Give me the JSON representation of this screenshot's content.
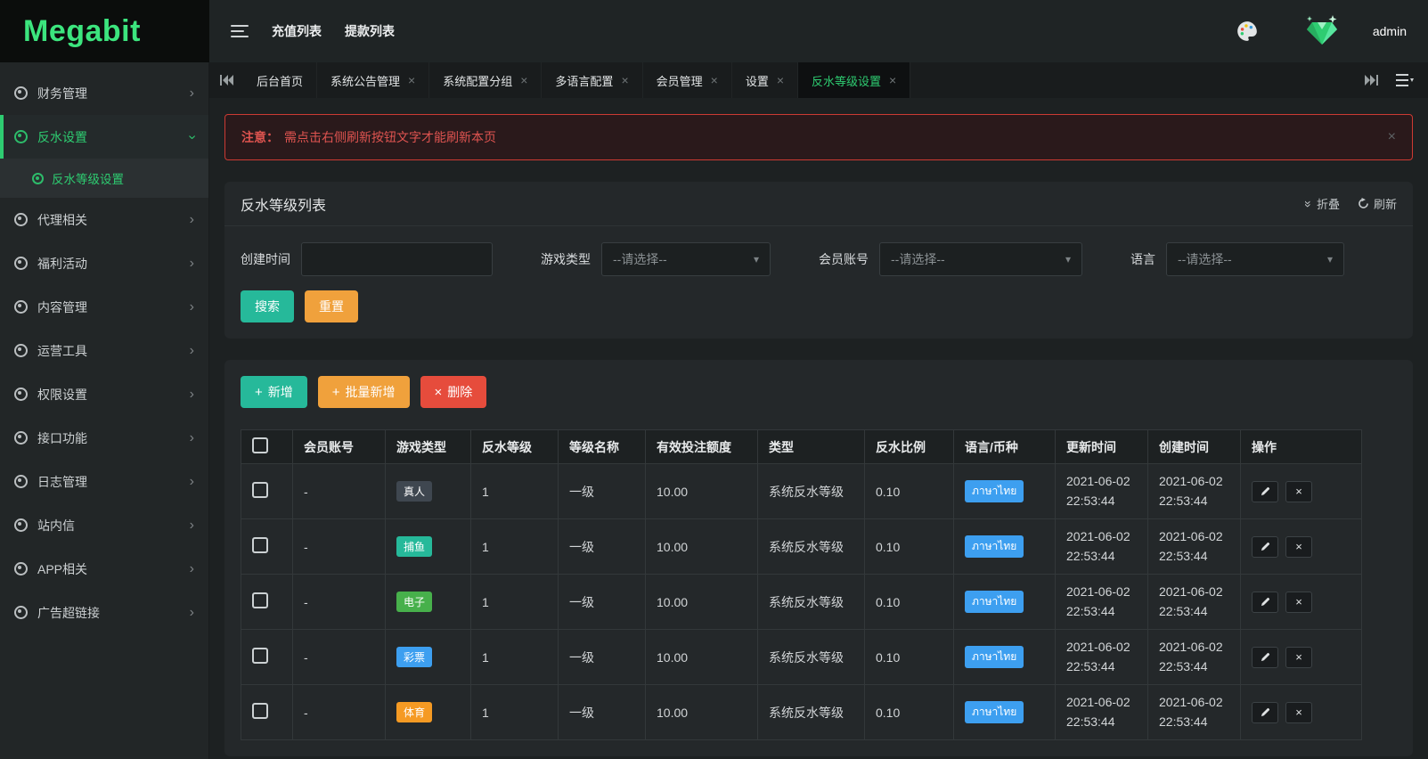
{
  "brand": {
    "logo_text": "Megabit"
  },
  "topnav": {
    "items": [
      "充值列表",
      "提款列表"
    ],
    "username": "admin"
  },
  "sidebar": {
    "items": [
      {
        "label": "财务管理"
      },
      {
        "label": "反水设置",
        "active": true,
        "expanded": true,
        "children": [
          {
            "label": "反水等级设置",
            "active": true
          }
        ]
      },
      {
        "label": "代理相关"
      },
      {
        "label": "福利活动"
      },
      {
        "label": "内容管理"
      },
      {
        "label": "运营工具"
      },
      {
        "label": "权限设置"
      },
      {
        "label": "接口功能"
      },
      {
        "label": "日志管理"
      },
      {
        "label": "站内信"
      },
      {
        "label": "APP相关"
      },
      {
        "label": "广告超链接"
      }
    ]
  },
  "tabs": [
    {
      "label": "后台首页",
      "closable": false
    },
    {
      "label": "系统公告管理",
      "closable": true
    },
    {
      "label": "系统配置分组",
      "closable": true
    },
    {
      "label": "多语言配置",
      "closable": true
    },
    {
      "label": "会员管理",
      "closable": true
    },
    {
      "label": "设置",
      "closable": true
    },
    {
      "label": "反水等级设置",
      "closable": true,
      "active": true
    }
  ],
  "alert": {
    "prefix": "注意：",
    "message": "需点击右侧刷新按钮文字才能刷新本页"
  },
  "panel": {
    "title": "反水等级列表",
    "collapse_label": "折叠",
    "refresh_label": "刷新"
  },
  "filters": {
    "created_time": {
      "label": "创建时间",
      "value": ""
    },
    "game_type": {
      "label": "游戏类型",
      "value": "--请选择--"
    },
    "member": {
      "label": "会员账号",
      "value": "--请选择--"
    },
    "language": {
      "label": "语言",
      "value": "--请选择--"
    },
    "search_label": "搜索",
    "reset_label": "重置"
  },
  "toolbar": {
    "add_label": "新增",
    "batch_add_label": "批量新增",
    "delete_label": "删除"
  },
  "table": {
    "headers": [
      "会员账号",
      "游戏类型",
      "反水等级",
      "等级名称",
      "有效投注额度",
      "类型",
      "反水比例",
      "语言/币种",
      "更新时间",
      "创建时间",
      "操作"
    ],
    "language_badge_color": "#3d9ff0",
    "rows": [
      {
        "account": "-",
        "game": {
          "text": "真人",
          "color": "#3f4750"
        },
        "level": "1",
        "level_name": "一级",
        "bet": "10.00",
        "type": "系统反水等级",
        "ratio": "0.10",
        "language": "ภาษาไทย",
        "updated": "2021-06-02 22:53:44",
        "created": "2021-06-02 22:53:44"
      },
      {
        "account": "-",
        "game": {
          "text": "捕鱼",
          "color": "#26b99a"
        },
        "level": "1",
        "level_name": "一级",
        "bet": "10.00",
        "type": "系统反水等级",
        "ratio": "0.10",
        "language": "ภาษาไทย",
        "updated": "2021-06-02 22:53:44",
        "created": "2021-06-02 22:53:44"
      },
      {
        "account": "-",
        "game": {
          "text": "电子",
          "color": "#47b04b"
        },
        "level": "1",
        "level_name": "一级",
        "bet": "10.00",
        "type": "系统反水等级",
        "ratio": "0.10",
        "language": "ภาษาไทย",
        "updated": "2021-06-02 22:53:44",
        "created": "2021-06-02 22:53:44"
      },
      {
        "account": "-",
        "game": {
          "text": "彩票",
          "color": "#3d9ff0"
        },
        "level": "1",
        "level_name": "一级",
        "bet": "10.00",
        "type": "系统反水等级",
        "ratio": "0.10",
        "language": "ภาษาไทย",
        "updated": "2021-06-02 22:53:44",
        "created": "2021-06-02 22:53:44"
      },
      {
        "account": "-",
        "game": {
          "text": "体育",
          "color": "#f59a23"
        },
        "level": "1",
        "level_name": "一级",
        "bet": "10.00",
        "type": "系统反水等级",
        "ratio": "0.10",
        "language": "ภาษาไทย",
        "updated": "2021-06-02 22:53:44",
        "created": "2021-06-02 22:53:44"
      }
    ]
  },
  "colors": {
    "accent_green": "#2ecc71",
    "teal": "#26b99a",
    "orange": "#f0a13c",
    "red": "#e64c3c"
  },
  "glyphs": {
    "chevron": "›",
    "caret_down": "▾",
    "close": "×",
    "collapse": "»",
    "plus": "+"
  }
}
